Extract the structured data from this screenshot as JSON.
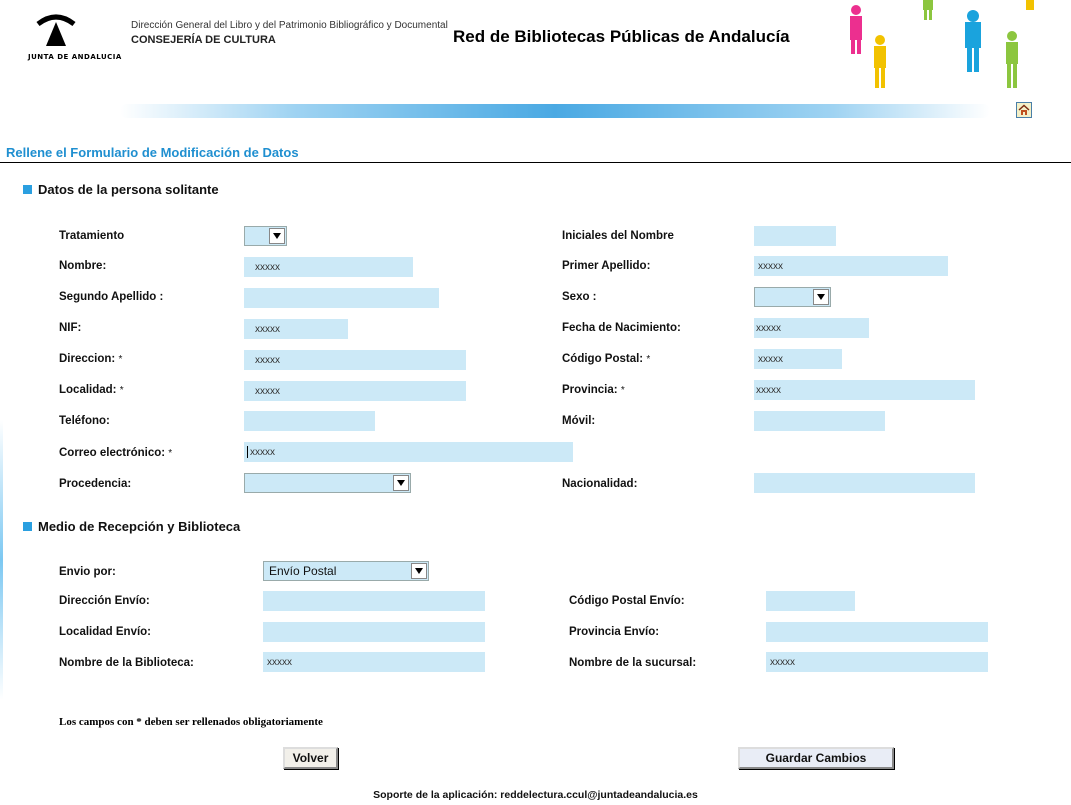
{
  "header": {
    "logo_text": "JUNTA DE ANDALUCIA",
    "directorate": "Dirección General del Libro y del Patrimonio Bibliográfico y Documental",
    "ministry": "CONSEJERÍA DE CULTURA",
    "site_title": "Red de Bibliotecas Públicas de Andalucía",
    "home_icon": "home-icon"
  },
  "form": {
    "heading": "Rellene el Formulario de Modificación de Datos",
    "section_personal": "Datos de la persona solitante",
    "section_delivery": "Medio de Recepción y Biblioteca",
    "labels": {
      "tratamiento": "Tratamiento",
      "nombre": "Nombre:",
      "segundo_apellido": "Segundo Apellido :",
      "nif": "NIF:",
      "direccion": "Direccion:",
      "localidad": "Localidad:",
      "telefono": "Teléfono:",
      "correo": "Correo electrónico:",
      "procedencia": "Procedencia:",
      "iniciales": "Iniciales del Nombre",
      "primer_apellido": "Primer Apellido:",
      "sexo": "Sexo :",
      "fecha_nacimiento": "Fecha de Nacimiento:",
      "codigo_postal": "Código Postal:",
      "provincia": "Provincia:",
      "movil": "Móvil:",
      "nacionalidad": "Nacionalidad:",
      "envio_por": "Envio por:",
      "direccion_envio": "Dirección Envío:",
      "localidad_envio": "Localidad Envío:",
      "nombre_biblioteca": "Nombre de la Biblioteca:",
      "codigo_postal_envio": "Código Postal Envío:",
      "provincia_envio": "Provincia Envío:",
      "nombre_sucursal": "Nombre de la sucursal:"
    },
    "required_mark": "*",
    "values": {
      "tratamiento": "",
      "nombre": "xxxxx",
      "segundo_apellido": "",
      "nif": "xxxxx",
      "direccion": "xxxxx",
      "localidad": "xxxxx",
      "telefono": "",
      "correo": "xxxxx",
      "procedencia": "",
      "iniciales": "",
      "primer_apellido": "xxxxx",
      "sexo": "",
      "fecha_nacimiento": "xxxxx",
      "codigo_postal": "xxxxx",
      "provincia": "xxxxx",
      "movil": "",
      "nacionalidad": "",
      "envio_por": "Envío Postal",
      "direccion_envio": "",
      "localidad_envio": "",
      "nombre_biblioteca": "xxxxx",
      "codigo_postal_envio": "",
      "provincia_envio": "",
      "nombre_sucursal": "xxxxx"
    },
    "required_note": "Los campos con * deben ser rellenados obligatoriamente",
    "buttons": {
      "back": "Volver",
      "save": "Guardar Cambios"
    }
  },
  "footer": {
    "support": "Soporte de la aplicación: reddelectura.ccul@juntadeandalucia.es"
  },
  "colors": {
    "accent": "#1f8fd0",
    "field_bg": "#cce9f7"
  }
}
